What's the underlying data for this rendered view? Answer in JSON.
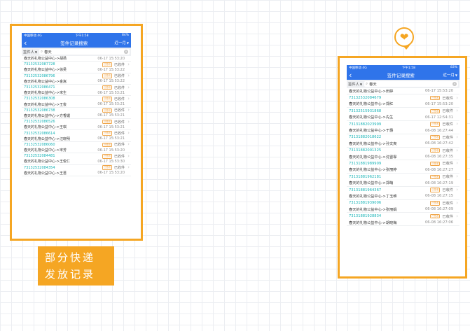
{
  "left_phone": {
    "status": {
      "carrier": "中国移动 4G",
      "time": "下午1:58",
      "battery": "84%"
    },
    "nav": {
      "back_icon": "‹",
      "title": "签件记录搜索",
      "filter": "近一月"
    },
    "search": {
      "select_label": "签件人",
      "query": "春天"
    },
    "first_entry": {
      "addr": "春天的礼物公益中心->胡扬",
      "time": "06-17 15:53:20"
    },
    "items": [
      {
        "tracking": "73132532087728",
        "badge": "已签收",
        "status": "已收件",
        "addr": "春天的礼物公益中心->徐吴",
        "time": "06-17 15:53:22"
      },
      {
        "tracking": "73132532086796",
        "badge": "已签收",
        "status": "已收件",
        "addr": "春天的礼物公益中心->金嵩",
        "time": "06-17 15:53:22"
      },
      {
        "tracking": "73132532086471",
        "badge": "已签收",
        "status": "已收件",
        "addr": "春天的礼物公益中心->宋生",
        "time": "06-17 15:53:21"
      },
      {
        "tracking": "73132532086308",
        "badge": "已签收",
        "status": "已收件",
        "addr": "春天的礼物公益中心->王俊",
        "time": "06-17 15:53:21"
      },
      {
        "tracking": "73132532086738",
        "badge": "已签收",
        "status": "已收件",
        "addr": "春天的礼物公益中心->方香媚",
        "time": "06-17 15:53:21"
      },
      {
        "tracking": "73132532086526",
        "badge": "已签收",
        "status": "已收件",
        "addr": "春天的礼物公益中心->王琪",
        "time": "06-17 15:53:21"
      },
      {
        "tracking": "73132532086614",
        "badge": "已签收",
        "status": "已收件",
        "addr": "春天的礼物公益中心->汪晓明",
        "time": "06-17 15:53:21"
      },
      {
        "tracking": "73132532086060",
        "badge": "已签收",
        "status": "已收件",
        "addr": "春天的礼物公益中心->宋芳",
        "time": "06-17 15:53:20"
      },
      {
        "tracking": "73132532084481",
        "badge": "已签收",
        "status": "已收件",
        "addr": "春天的礼物公益中心->王俊仁",
        "time": "06-17 15:53:30"
      },
      {
        "tracking": "73132532084354",
        "badge": "已签收",
        "status": "已收件",
        "addr": "春天的礼物公益中心->王蔷",
        "time": "06-17 15:53:20"
      }
    ]
  },
  "right_phone": {
    "status": {
      "carrier": "中国移动 4G",
      "time": "下午1:58",
      "battery": "83%"
    },
    "nav": {
      "back_icon": "‹",
      "title": "签件记录搜索",
      "filter": "近一月"
    },
    "search": {
      "select_label": "签件人",
      "query": "春天"
    },
    "first_entry": {
      "addr": "春天的礼物公益中心->田婷",
      "time": "06-17 15:53:20"
    },
    "items": [
      {
        "tracking": "73132532084679",
        "badge": "已签收",
        "status": "已收件",
        "addr": "春天的礼物公益中心->郑红",
        "time": "06-17 15:53:20"
      },
      {
        "tracking": "73132515931868",
        "badge": "已签收",
        "status": "已收件",
        "addr": "春天的礼物公益中心->先生",
        "time": "06-17 12:54:31"
      },
      {
        "tracking": "73131882023999",
        "badge": "已签收",
        "status": "已收件",
        "addr": "春天的礼物公益中心->于爵",
        "time": "06-08 16:27:44"
      },
      {
        "tracking": "73131882018622",
        "badge": "已签收",
        "status": "已收件",
        "addr": "春天的礼物公益中心->孙文爽",
        "time": "06-08 16:27:42"
      },
      {
        "tracking": "73131882001325",
        "badge": "已签收",
        "status": "已收件",
        "addr": "春天的礼物公益中心->沈雷霏",
        "time": "06-08 16:27:35"
      },
      {
        "tracking": "73131881989909",
        "badge": "已签收",
        "status": "已收件",
        "addr": "春天的礼物公益中心->张丽婷",
        "time": "06-08 16:27:27"
      },
      {
        "tracking": "73131881962181",
        "badge": "已签收",
        "status": "已收件",
        "addr": "春天的礼物公益中心->郑萌",
        "time": "06-08 16:27:19"
      },
      {
        "tracking": "73131881964367",
        "badge": "已签收",
        "status": "已收件",
        "addr": "春天的礼物公益中心->丁玉维",
        "time": "06-08 16:27:15"
      },
      {
        "tracking": "73131881939006",
        "badge": "已签收",
        "status": "已收件",
        "addr": "春天的礼物公益中心->张丽娟",
        "time": "06-08 16:27:09"
      },
      {
        "tracking": "73131881928834",
        "badge": "已签收",
        "status": "已收件",
        "addr": "春天的礼物公益中心->胡晓梅",
        "time": "06-08 16:27:06"
      }
    ]
  },
  "caption": {
    "line1": "部分快递",
    "line2": "发放记录"
  },
  "colors": {
    "accent": "#f5a623",
    "nav_blue": "#2f74ea",
    "tracking": "#17b3b6"
  },
  "heart_icon": "heart-icon"
}
